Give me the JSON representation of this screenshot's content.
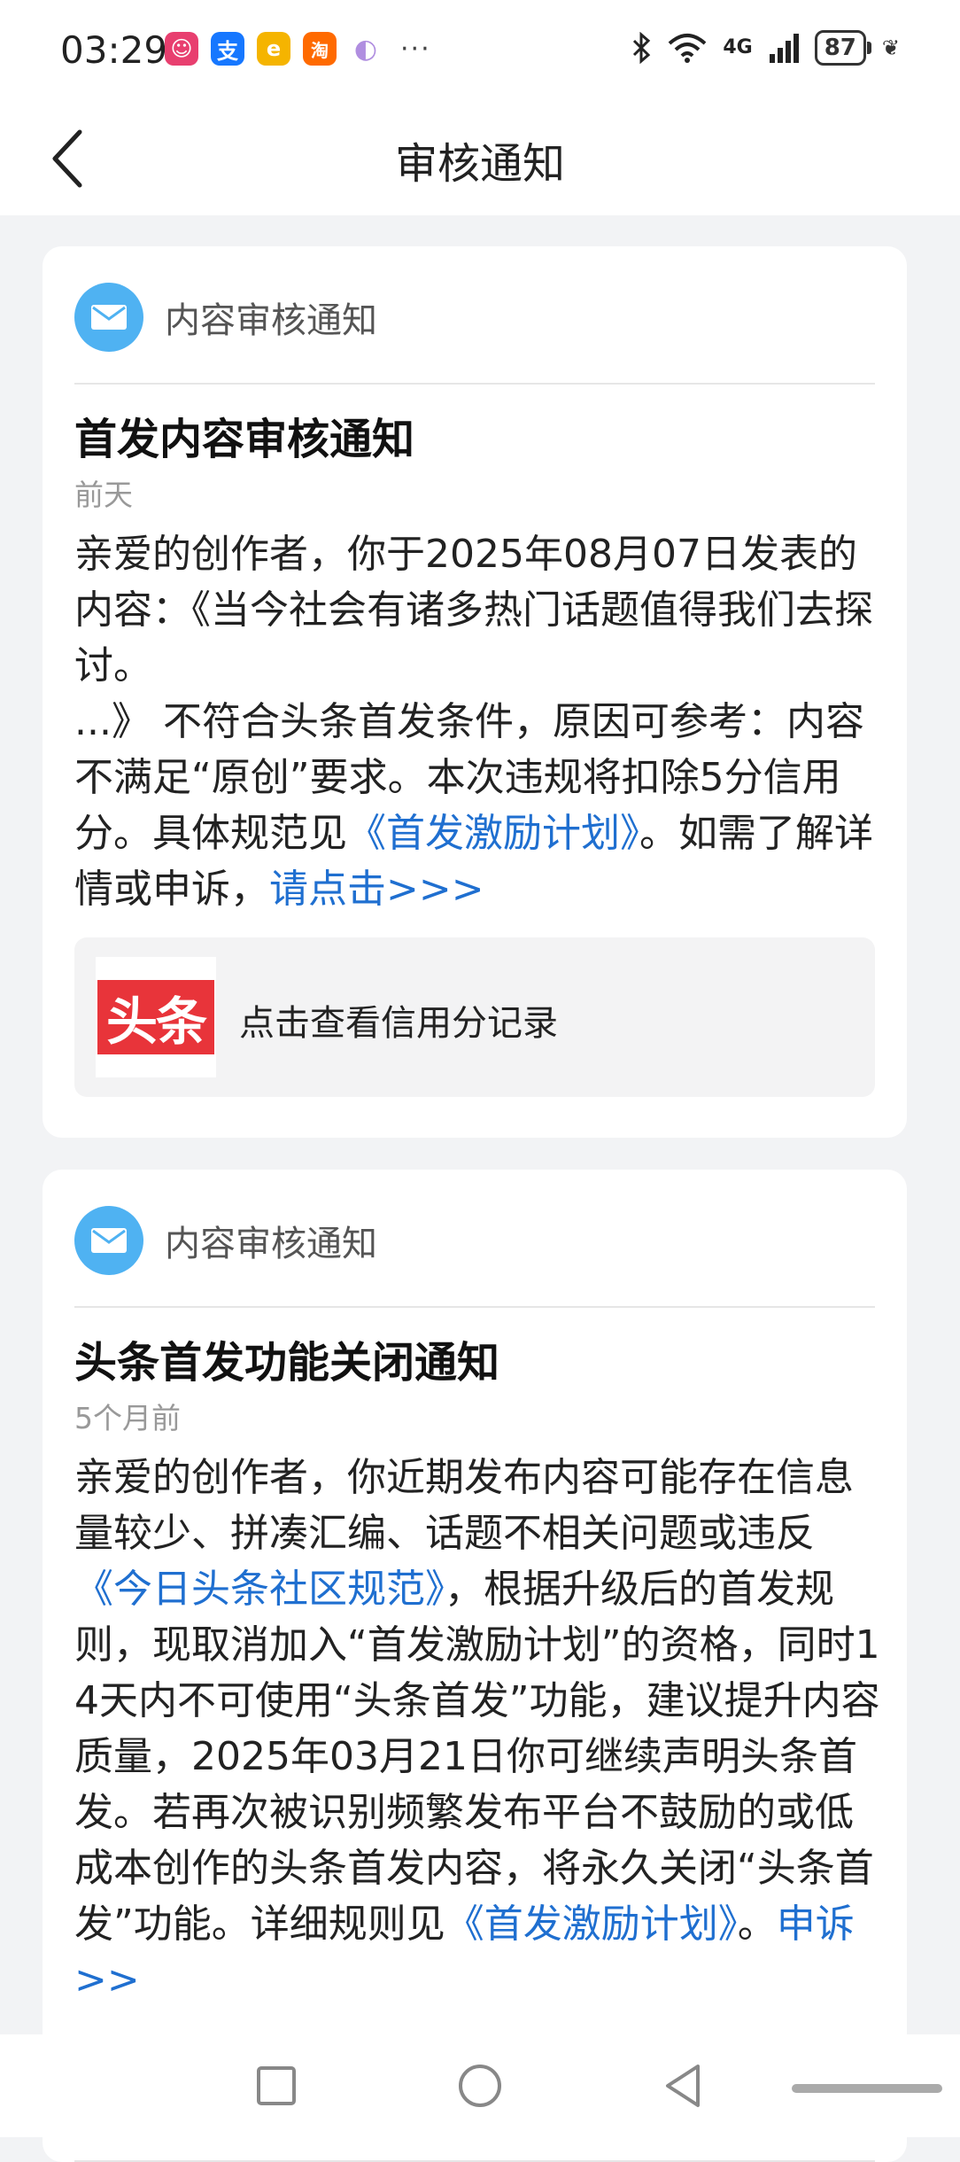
{
  "status_bar": {
    "time": "03:29",
    "apps": [
      {
        "icon": "app-icon-1",
        "color": "#e83f6f",
        "glyph": "☺"
      },
      {
        "icon": "alipay-icon",
        "color": "#1677ff",
        "glyph": "支"
      },
      {
        "icon": "app-icon-3",
        "color": "#f5b400",
        "glyph": "e"
      },
      {
        "icon": "taobao-icon",
        "color": "#ff6a00",
        "glyph": "淘"
      },
      {
        "icon": "app-icon-5",
        "color": "#c9a7f0",
        "glyph": "◐"
      }
    ],
    "more": "···",
    "network": "4G",
    "battery": "87"
  },
  "header": {
    "title": "审核通知"
  },
  "cards": [
    {
      "type_label": "内容审核通知",
      "title": "首发内容审核通知",
      "date": "前天",
      "body_1": "亲爱的创作者，你于2025年08月07日发表的内容：《当今社会有诸多热门话题值得我们去探讨。",
      "body_2": "...》 不符合头条首发条件，原因可参考：内容不满足“原创”要求。本次违规将扣除5分信用分。具体规范见",
      "link_1": "《首发激励计划》",
      "body_3": "。如需了解详情或申诉，",
      "link_2": "请点击>>>",
      "credit_entry": {
        "logo_text": "头条",
        "label": "点击查看信用分记录"
      }
    },
    {
      "type_label": "内容审核通知",
      "title": "头条首发功能关闭通知",
      "date": "5个月前",
      "body_1": "亲爱的创作者，你近期发布内容可能存在信息量较少、拼凑汇编、话题不相关问题或违反",
      "link_1": "《今日头条社区规范》",
      "body_2": "，根据升级后的首发规则，现取消加入“首发激励计划”的资格，同时14天内不可使用“头条首发”功能，建议提升内容质量，2025年03月21日你可继续声明头条首发。若再次被识别频繁发布平台不鼓励的或低成本创作的头条首发内容，将永久关闭“头条首发”功能。详细规则见",
      "link_2": "《首发激励计划》",
      "body_3": "。",
      "link_3": "申诉>>"
    }
  ],
  "colors": {
    "link": "#1f6fd0",
    "mail_icon_bg": "#4fb2f2",
    "logo_red": "#e8343a"
  }
}
